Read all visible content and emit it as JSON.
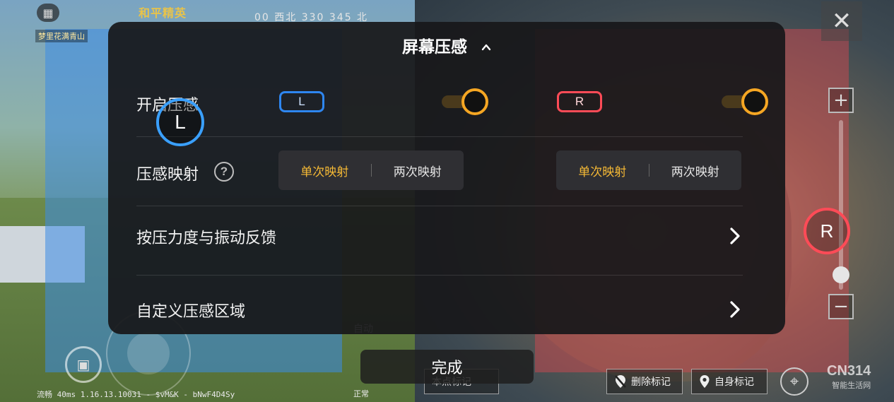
{
  "game_hud": {
    "title": "和平精英",
    "compass": "00  西北  330  345  北",
    "player_tag": "梦里花满青山",
    "close_glyph": "✕",
    "zoom_plus": "+",
    "zoom_minus": "−",
    "left_badge": "L",
    "right_badge": "R",
    "status_bar": "流畅 40ms 1.16.13.10031 - $vM&K - bNwF4D4Sy",
    "auto_label": "自动",
    "normal_label": "正常",
    "map_buttons": {
      "partial": "本点标记",
      "delete": "删除标记",
      "self": "自身标记"
    },
    "watermark": {
      "line1": "CN314",
      "line2": "智能生活网"
    }
  },
  "panel": {
    "title": "屏幕压感",
    "rows": {
      "enable": {
        "label": "开启压感",
        "left_badge": "L",
        "right_badge": "R",
        "left_on": true,
        "right_on": true
      },
      "mapping": {
        "label": "压感映射",
        "help_glyph": "?",
        "left_options": [
          "单次映射",
          "两次映射"
        ],
        "right_options": [
          "单次映射",
          "两次映射"
        ],
        "left_selected": "单次映射",
        "right_selected": "单次映射"
      },
      "feedback": {
        "label": "按压力度与振动反馈"
      },
      "custom_area": {
        "label": "自定义压感区域"
      }
    },
    "done_label": "完成"
  },
  "colors": {
    "accent_orange": "#f5a623",
    "accent_yellow": "#f5b935",
    "left_blue": "#2e86f0",
    "right_red": "#ff4b57",
    "panel_bg": "#18181a"
  }
}
